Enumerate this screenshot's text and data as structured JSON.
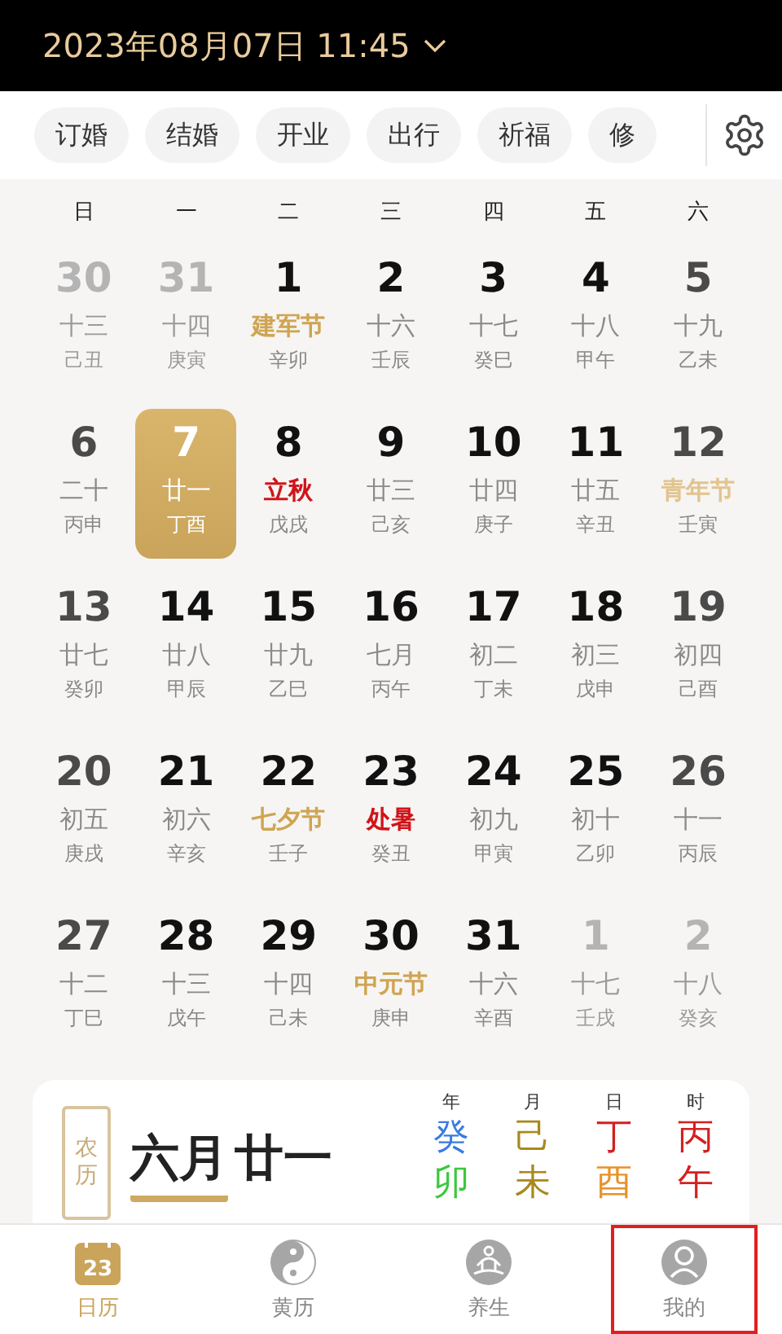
{
  "header": {
    "datetime": "2023年08月07日 11:45"
  },
  "chips": [
    "订婚",
    "结婚",
    "开业",
    "出行",
    "祈福",
    "修"
  ],
  "weekdays": [
    "日",
    "一",
    "二",
    "三",
    "四",
    "五",
    "六"
  ],
  "weeks": [
    [
      {
        "day": "30",
        "lunar": "十三",
        "ganzhi": "己丑",
        "kind": "lunar",
        "muted": true,
        "selected": false
      },
      {
        "day": "31",
        "lunar": "十四",
        "ganzhi": "庚寅",
        "kind": "lunar",
        "muted": true,
        "selected": false
      },
      {
        "day": "1",
        "lunar": "建军节",
        "ganzhi": "辛卯",
        "kind": "festival",
        "muted": false,
        "selected": false
      },
      {
        "day": "2",
        "lunar": "十六",
        "ganzhi": "壬辰",
        "kind": "lunar",
        "muted": false,
        "selected": false
      },
      {
        "day": "3",
        "lunar": "十七",
        "ganzhi": "癸巳",
        "kind": "lunar",
        "muted": false,
        "selected": false
      },
      {
        "day": "4",
        "lunar": "十八",
        "ganzhi": "甲午",
        "kind": "lunar",
        "muted": false,
        "selected": false
      },
      {
        "day": "5",
        "lunar": "十九",
        "ganzhi": "乙未",
        "kind": "lunar",
        "muted": false,
        "selected": false
      }
    ],
    [
      {
        "day": "6",
        "lunar": "二十",
        "ganzhi": "丙申",
        "kind": "lunar",
        "muted": false,
        "selected": false
      },
      {
        "day": "7",
        "lunar": "廿一",
        "ganzhi": "丁酉",
        "kind": "lunar",
        "muted": false,
        "selected": true
      },
      {
        "day": "8",
        "lunar": "立秋",
        "ganzhi": "戊戌",
        "kind": "term",
        "muted": false,
        "selected": false
      },
      {
        "day": "9",
        "lunar": "廿三",
        "ganzhi": "己亥",
        "kind": "lunar",
        "muted": false,
        "selected": false
      },
      {
        "day": "10",
        "lunar": "廿四",
        "ganzhi": "庚子",
        "kind": "lunar",
        "muted": false,
        "selected": false
      },
      {
        "day": "11",
        "lunar": "廿五",
        "ganzhi": "辛丑",
        "kind": "lunar",
        "muted": false,
        "selected": false
      },
      {
        "day": "12",
        "lunar": "青年节",
        "ganzhi": "壬寅",
        "kind": "festival",
        "muted": false,
        "selected": false
      }
    ],
    [
      {
        "day": "13",
        "lunar": "廿七",
        "ganzhi": "癸卯",
        "kind": "lunar",
        "muted": false,
        "selected": false
      },
      {
        "day": "14",
        "lunar": "廿八",
        "ganzhi": "甲辰",
        "kind": "lunar",
        "muted": false,
        "selected": false
      },
      {
        "day": "15",
        "lunar": "廿九",
        "ganzhi": "乙巳",
        "kind": "lunar",
        "muted": false,
        "selected": false
      },
      {
        "day": "16",
        "lunar": "七月",
        "ganzhi": "丙午",
        "kind": "lunar",
        "muted": false,
        "selected": false
      },
      {
        "day": "17",
        "lunar": "初二",
        "ganzhi": "丁未",
        "kind": "lunar",
        "muted": false,
        "selected": false
      },
      {
        "day": "18",
        "lunar": "初三",
        "ganzhi": "戊申",
        "kind": "lunar",
        "muted": false,
        "selected": false
      },
      {
        "day": "19",
        "lunar": "初四",
        "ganzhi": "己酉",
        "kind": "lunar",
        "muted": false,
        "selected": false
      }
    ],
    [
      {
        "day": "20",
        "lunar": "初五",
        "ganzhi": "庚戌",
        "kind": "lunar",
        "muted": false,
        "selected": false
      },
      {
        "day": "21",
        "lunar": "初六",
        "ganzhi": "辛亥",
        "kind": "lunar",
        "muted": false,
        "selected": false
      },
      {
        "day": "22",
        "lunar": "七夕节",
        "ganzhi": "壬子",
        "kind": "festival",
        "muted": false,
        "selected": false
      },
      {
        "day": "23",
        "lunar": "处暑",
        "ganzhi": "癸丑",
        "kind": "term",
        "muted": false,
        "selected": false
      },
      {
        "day": "24",
        "lunar": "初九",
        "ganzhi": "甲寅",
        "kind": "lunar",
        "muted": false,
        "selected": false
      },
      {
        "day": "25",
        "lunar": "初十",
        "ganzhi": "乙卯",
        "kind": "lunar",
        "muted": false,
        "selected": false
      },
      {
        "day": "26",
        "lunar": "十一",
        "ganzhi": "丙辰",
        "kind": "lunar",
        "muted": false,
        "selected": false
      }
    ],
    [
      {
        "day": "27",
        "lunar": "十二",
        "ganzhi": "丁巳",
        "kind": "lunar",
        "muted": false,
        "selected": false
      },
      {
        "day": "28",
        "lunar": "十三",
        "ganzhi": "戊午",
        "kind": "lunar",
        "muted": false,
        "selected": false
      },
      {
        "day": "29",
        "lunar": "十四",
        "ganzhi": "己未",
        "kind": "lunar",
        "muted": false,
        "selected": false
      },
      {
        "day": "30",
        "lunar": "中元节",
        "ganzhi": "庚申",
        "kind": "festival",
        "muted": false,
        "selected": false
      },
      {
        "day": "31",
        "lunar": "十六",
        "ganzhi": "辛酉",
        "kind": "lunar",
        "muted": false,
        "selected": false
      },
      {
        "day": "1",
        "lunar": "十七",
        "ganzhi": "壬戌",
        "kind": "lunar",
        "muted": true,
        "selected": false
      },
      {
        "day": "2",
        "lunar": "十八",
        "ganzhi": "癸亥",
        "kind": "lunar",
        "muted": true,
        "selected": false
      }
    ]
  ],
  "lunar_card": {
    "seal": "农历",
    "month": "六月",
    "day": "廿一",
    "pillar_labels": [
      "年",
      "月",
      "日",
      "时"
    ],
    "stems": [
      {
        "text": "癸",
        "color": "#3a7be0"
      },
      {
        "text": "己",
        "color": "#a8891c"
      },
      {
        "text": "丁",
        "color": "#d42020"
      },
      {
        "text": "丙",
        "color": "#d42020"
      }
    ],
    "branches": [
      {
        "text": "卯",
        "color": "#3cc83c"
      },
      {
        "text": "未",
        "color": "#a8891c"
      },
      {
        "text": "酉",
        "color": "#e8922a"
      },
      {
        "text": "午",
        "color": "#d42020"
      }
    ]
  },
  "nav": [
    {
      "label": "日历",
      "kind": "calendar",
      "badge": "23",
      "selected": true,
      "highlighted": false
    },
    {
      "label": "黄历",
      "kind": "yinyang",
      "selected": false,
      "highlighted": false
    },
    {
      "label": "养生",
      "kind": "meditation",
      "selected": false,
      "highlighted": false
    },
    {
      "label": "我的",
      "kind": "profile",
      "selected": false,
      "highlighted": true
    }
  ]
}
